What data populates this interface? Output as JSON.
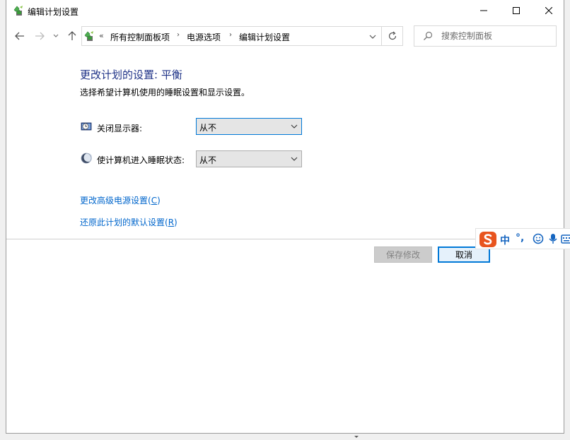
{
  "window": {
    "title": "编辑计划设置",
    "minimize_icon": "minimize-icon",
    "maximize_icon": "maximize-icon",
    "close_icon": "close-icon"
  },
  "nav": {
    "back_icon": "arrow-left-icon",
    "forward_icon": "arrow-right-icon",
    "recent_icon": "chevron-down-icon",
    "up_icon": "arrow-up-icon"
  },
  "address": {
    "overflow": "«",
    "breadcrumbs": [
      "所有控制面板项",
      "电源选项",
      "编辑计划设置"
    ],
    "separator": "›",
    "refresh_icon": "refresh-icon"
  },
  "search": {
    "placeholder": "搜索控制面板"
  },
  "main": {
    "title": "更改计划的设置: 平衡",
    "subtitle": "选择希望计算机使用的睡眠设置和显示设置。",
    "display_off": {
      "label": "关闭显示器:",
      "value": "从不"
    },
    "sleep": {
      "label": "使计算机进入睡眠状态:",
      "value": "从不"
    },
    "link_advanced_pre": "更改高级电源设置(",
    "link_advanced_key": "C",
    "link_advanced_post": ")",
    "link_restore_pre": "还原此计划的默认设置(",
    "link_restore_key": "R",
    "link_restore_post": ")"
  },
  "buttons": {
    "save": "保存修改",
    "cancel": "取消"
  },
  "ime": {
    "mode": "中",
    "punct": "°,"
  },
  "colors": {
    "heading": "#1e3287",
    "link": "#0066cc",
    "focus": "#0078d7",
    "ime_logo": "#e8541e"
  }
}
